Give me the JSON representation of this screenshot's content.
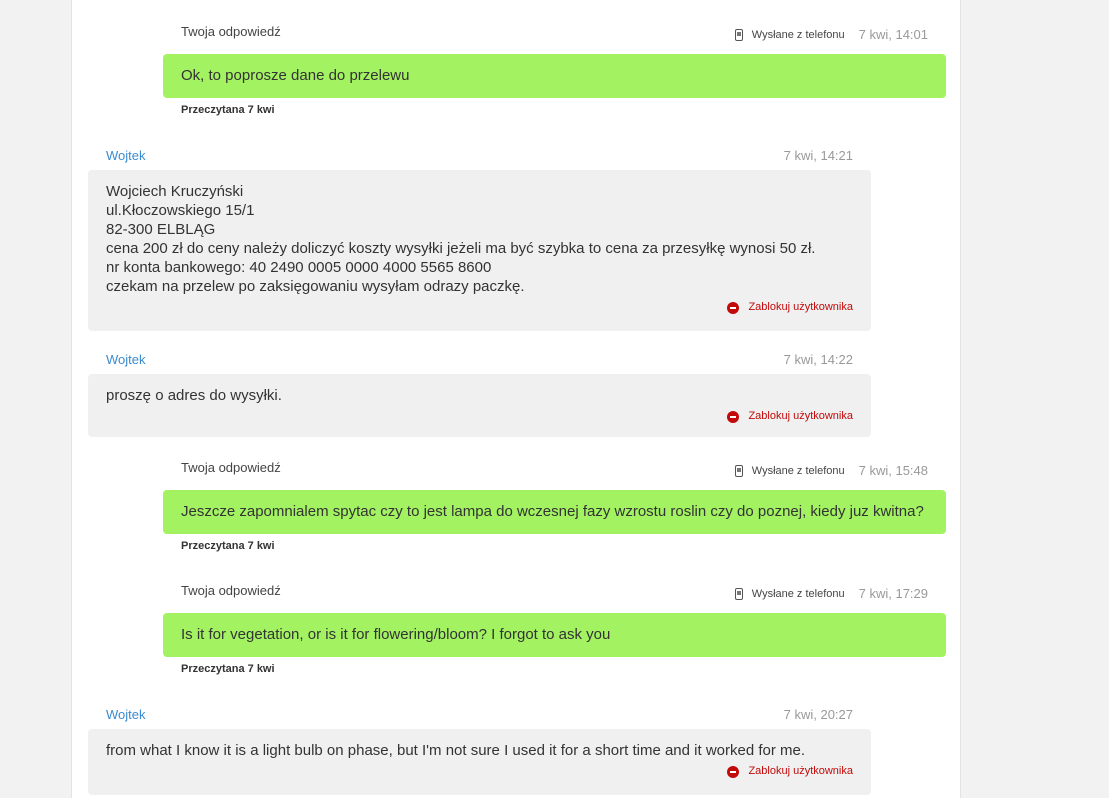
{
  "messages": [
    {
      "kind": "out",
      "author": "Twoja odpowiedź",
      "sent_from": "Wysłane z telefonu",
      "time": "7 kwi, 14:01",
      "text": "Ok, to poprosze dane do przelewu",
      "status": "Przeczytana 7 kwi"
    },
    {
      "kind": "in",
      "author": "Wojtek",
      "time": "7 kwi, 14:21",
      "lines": [
        "Wojciech Kruczyński",
        "ul.Kłoczowskiego 15/1",
        "82-300 ELBLĄG",
        "cena 200 zł do ceny należy doliczyć koszty wysyłki jeżeli ma być szybka to cena za przesyłkę wynosi 50 zł.",
        "nr konta bankowego: 40 2490 0005 0000 4000 5565 8600",
        "czekam na przelew po zaksięgowaniu wysyłam odrazy paczkę."
      ],
      "block_label": "Zablokuj użytkownika"
    },
    {
      "kind": "in",
      "author": "Wojtek",
      "time": "7 kwi, 14:22",
      "lines": [
        "proszę o adres do wysyłki."
      ],
      "block_label": "Zablokuj użytkownika"
    },
    {
      "kind": "out",
      "author": "Twoja odpowiedź",
      "sent_from": "Wysłane z telefonu",
      "time": "7 kwi, 15:48",
      "text": "Jeszcze zapomnialem spytac czy to jest lampa do wczesnej fazy wzrostu roslin czy do poznej, kiedy juz kwitna?",
      "status": "Przeczytana 7 kwi"
    },
    {
      "kind": "out",
      "author": "Twoja odpowiedź",
      "sent_from": "Wysłane z telefonu",
      "time": "7 kwi, 17:29",
      "text": "Is it for vegetation, or is it for flowering/bloom? I forgot to ask you",
      "status": "Przeczytana 7 kwi"
    },
    {
      "kind": "in",
      "author": "Wojtek",
      "time": "7 kwi, 20:27",
      "lines": [
        "from what I know it is a light bulb on phase, but I'm not sure I used it for a short time and it worked for me."
      ],
      "block_label": "Zablokuj użytkownika"
    }
  ],
  "colors": {
    "outgoing_bubble": "#a3f261",
    "incoming_bubble": "#f0f0f0",
    "author_link": "#3a8bd0",
    "block_red": "#c20a0a"
  },
  "icons": {
    "sent_from": "phone-icon",
    "block": "block-user-icon"
  }
}
